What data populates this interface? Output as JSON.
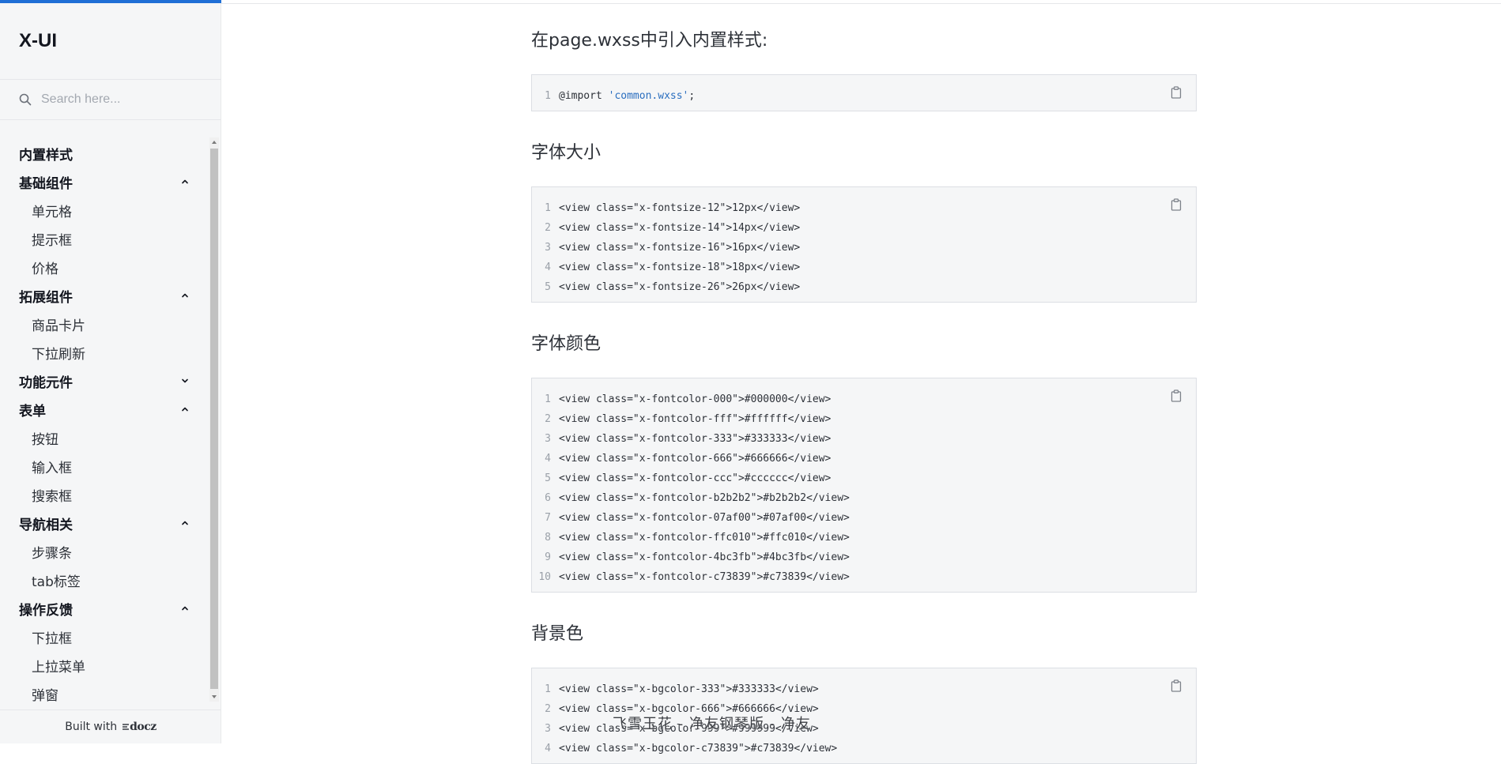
{
  "app": {
    "logo": "X-UI",
    "accent_color": "#1f6fd6"
  },
  "search": {
    "placeholder": "Search here...",
    "icon": "search-icon"
  },
  "sidebar": {
    "nav": [
      {
        "type": "group",
        "label": "内置样式"
      },
      {
        "type": "group",
        "label": "基础组件",
        "icon": "chevron-up-icon"
      },
      {
        "type": "item",
        "label": "单元格"
      },
      {
        "type": "item",
        "label": "提示框"
      },
      {
        "type": "item",
        "label": "价格"
      },
      {
        "type": "group",
        "label": "拓展组件",
        "icon": "chevron-up-icon"
      },
      {
        "type": "item",
        "label": "商品卡片"
      },
      {
        "type": "item",
        "label": "下拉刷新"
      },
      {
        "type": "group",
        "label": "功能元件",
        "icon": "chevron-down-icon"
      },
      {
        "type": "group",
        "label": "表单",
        "icon": "chevron-up-icon"
      },
      {
        "type": "item",
        "label": "按钮"
      },
      {
        "type": "item",
        "label": "输入框"
      },
      {
        "type": "item",
        "label": "搜索框"
      },
      {
        "type": "group",
        "label": "导航相关",
        "icon": "chevron-up-icon"
      },
      {
        "type": "item",
        "label": "步骤条"
      },
      {
        "type": "item",
        "label": "tab标签"
      },
      {
        "type": "group",
        "label": "操作反馈",
        "icon": "chevron-up-icon"
      },
      {
        "type": "item",
        "label": "下拉框"
      },
      {
        "type": "item",
        "label": "上拉菜单"
      },
      {
        "type": "item",
        "label": "弹窗"
      }
    ],
    "footer": {
      "built_with": "Built with",
      "brand": "docz"
    }
  },
  "main": {
    "sections": [
      {
        "heading": "在page.wxss中引入内置样式:",
        "lines": [
          {
            "n": "1",
            "parts": [
              {
                "t": "@import "
              },
              {
                "t": "'common.wxss'",
                "c": "str"
              },
              {
                "t": ";"
              }
            ]
          }
        ]
      },
      {
        "heading": "字体大小",
        "lines": [
          {
            "n": "1",
            "parts": [
              {
                "t": "<view class=\"x-fontsize-12\">12px</view>"
              }
            ]
          },
          {
            "n": "2",
            "parts": [
              {
                "t": "<view class=\"x-fontsize-14\">14px</view>"
              }
            ]
          },
          {
            "n": "3",
            "parts": [
              {
                "t": "<view class=\"x-fontsize-16\">16px</view>"
              }
            ]
          },
          {
            "n": "4",
            "parts": [
              {
                "t": "<view class=\"x-fontsize-18\">18px</view>"
              }
            ]
          },
          {
            "n": "5",
            "parts": [
              {
                "t": "<view class=\"x-fontsize-26\">26px</view>"
              }
            ]
          }
        ]
      },
      {
        "heading": "字体颜色",
        "lines": [
          {
            "n": "1",
            "parts": [
              {
                "t": "<view class=\"x-fontcolor-000\">#000000</view>"
              }
            ]
          },
          {
            "n": "2",
            "parts": [
              {
                "t": "<view class=\"x-fontcolor-fff\">#ffffff</view>"
              }
            ]
          },
          {
            "n": "3",
            "parts": [
              {
                "t": "<view class=\"x-fontcolor-333\">#333333</view>"
              }
            ]
          },
          {
            "n": "4",
            "parts": [
              {
                "t": "<view class=\"x-fontcolor-666\">#666666</view>"
              }
            ]
          },
          {
            "n": "5",
            "parts": [
              {
                "t": "<view class=\"x-fontcolor-ccc\">#cccccc</view>"
              }
            ]
          },
          {
            "n": "6",
            "parts": [
              {
                "t": "<view class=\"x-fontcolor-b2b2b2\">#b2b2b2</view>"
              }
            ]
          },
          {
            "n": "7",
            "parts": [
              {
                "t": "<view class=\"x-fontcolor-07af00\">#07af00</view>"
              }
            ]
          },
          {
            "n": "8",
            "parts": [
              {
                "t": "<view class=\"x-fontcolor-ffc010\">#ffc010</view>"
              }
            ]
          },
          {
            "n": "9",
            "parts": [
              {
                "t": "<view class=\"x-fontcolor-4bc3fb\">#4bc3fb</view>"
              }
            ]
          },
          {
            "n": "10",
            "parts": [
              {
                "t": "<view class=\"x-fontcolor-c73839\">#c73839</view>"
              }
            ]
          }
        ]
      },
      {
        "heading": "背景色",
        "lines": [
          {
            "n": "1",
            "parts": [
              {
                "t": "<view class=\"x-bgcolor-333\">#333333</view>"
              }
            ]
          },
          {
            "n": "2",
            "parts": [
              {
                "t": "<view class=\"x-bgcolor-666\">#666666</view>"
              }
            ]
          },
          {
            "n": "3",
            "parts": [
              {
                "t": "<view class=\"x-bgcolor-999\">#999999</view>"
              }
            ]
          },
          {
            "n": "4",
            "parts": [
              {
                "t": "<view class=\"x-bgcolor-c73839\">#c73839</view>"
              }
            ]
          }
        ]
      }
    ]
  },
  "overlay": {
    "subtitle": "飞雪玉花 - 净友钢琴版 - 净友"
  }
}
